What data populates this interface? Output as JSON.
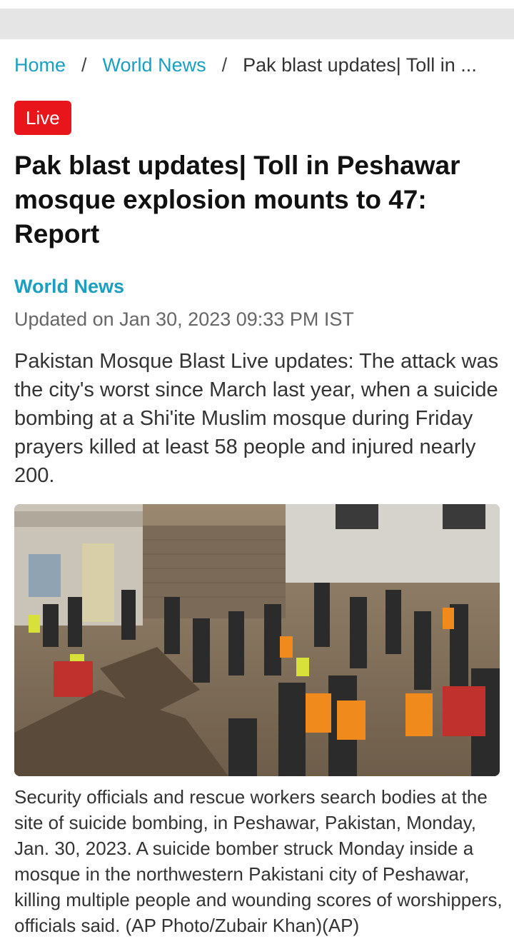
{
  "breadcrumb": {
    "home": "Home",
    "section": "World News",
    "current": "Pak blast updates| Toll in ...",
    "separator": "/"
  },
  "badge": {
    "label": "Live",
    "color": "#e8151b"
  },
  "article": {
    "headline": "Pak blast updates| Toll in Peshawar mosque explosion mounts to 47: Report",
    "category": "World News",
    "updated": "Updated on Jan 30, 2023 09:33 PM IST",
    "summary": "Pakistan Mosque Blast Live updates: The attack was the city's worst since March last year, when a suicide bombing at a Shi'ite Muslim mosque during Friday prayers killed at least 58 people and injured nearly 200.",
    "image_caption": "Security officials and rescue workers search bodies at the site of suicide bombing, in Peshawar, Pakistan, Monday, Jan. 30, 2023. A suicide bomber struck Monday inside a mosque in the northwestern Pakistani city of Peshawar, killing multiple people and wounding scores of worshippers, officials said. (AP Photo/Zubair Khan)(AP)"
  },
  "colors": {
    "accent": "#1a9fc0",
    "live": "#e8151b",
    "top_strip": "#e5e5e5"
  }
}
